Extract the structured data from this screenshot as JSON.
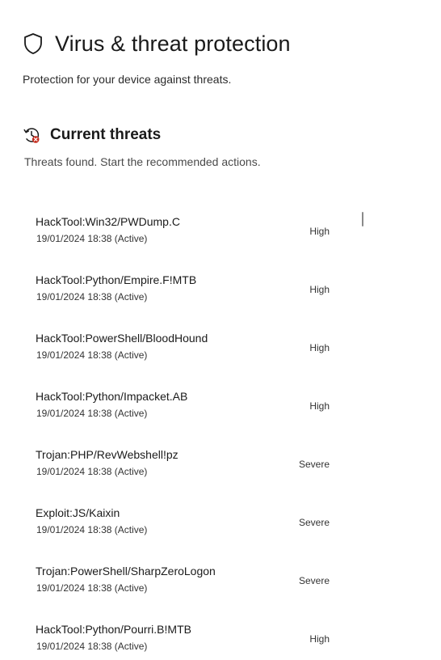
{
  "header": {
    "title": "Virus & threat protection",
    "subtitle": "Protection for your device against threats.",
    "icon": "shield-icon"
  },
  "current_threats": {
    "title": "Current threats",
    "subtitle": "Threats found. Start the recommended actions.",
    "icon": "history-alert-icon"
  },
  "threats": [
    {
      "name": "HackTool:Win32/PWDump.C",
      "date": "19/01/2024 18:38 (Active)",
      "severity": "High"
    },
    {
      "name": "HackTool:Python/Empire.F!MTB",
      "date": "19/01/2024 18:38 (Active)",
      "severity": "High"
    },
    {
      "name": "HackTool:PowerShell/BloodHound",
      "date": "19/01/2024 18:38 (Active)",
      "severity": "High"
    },
    {
      "name": "HackTool:Python/Impacket.AB",
      "date": "19/01/2024 18:38 (Active)",
      "severity": "High"
    },
    {
      "name": "Trojan:PHP/RevWebshell!pz",
      "date": "19/01/2024 18:38 (Active)",
      "severity": "Severe"
    },
    {
      "name": "Exploit:JS/Kaixin",
      "date": "19/01/2024 18:38 (Active)",
      "severity": "Severe"
    },
    {
      "name": "Trojan:PowerShell/SharpZeroLogon",
      "date": "19/01/2024 18:38 (Active)",
      "severity": "Severe"
    },
    {
      "name": "HackTool:Python/Pourri.B!MTB",
      "date": "19/01/2024 18:38 (Active)",
      "severity": "High"
    }
  ],
  "colors": {
    "alert_red": "#c42b1c",
    "text": "#1b1b1b"
  }
}
